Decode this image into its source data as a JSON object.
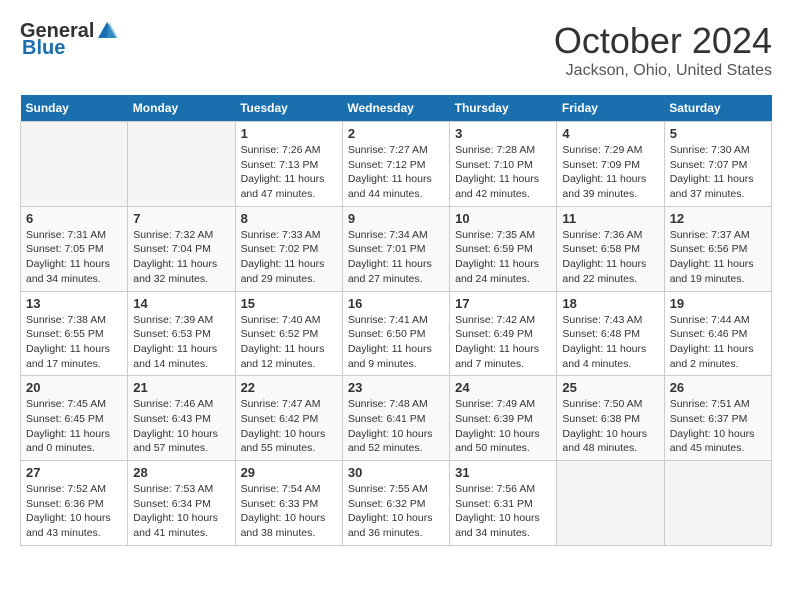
{
  "logo": {
    "general": "General",
    "blue": "Blue"
  },
  "title": {
    "month": "October 2024",
    "location": "Jackson, Ohio, United States"
  },
  "weekdays": [
    "Sunday",
    "Monday",
    "Tuesday",
    "Wednesday",
    "Thursday",
    "Friday",
    "Saturday"
  ],
  "weeks": [
    [
      {
        "day": "",
        "info": ""
      },
      {
        "day": "",
        "info": ""
      },
      {
        "day": "1",
        "info": "Sunrise: 7:26 AM\nSunset: 7:13 PM\nDaylight: 11 hours\nand 47 minutes."
      },
      {
        "day": "2",
        "info": "Sunrise: 7:27 AM\nSunset: 7:12 PM\nDaylight: 11 hours\nand 44 minutes."
      },
      {
        "day": "3",
        "info": "Sunrise: 7:28 AM\nSunset: 7:10 PM\nDaylight: 11 hours\nand 42 minutes."
      },
      {
        "day": "4",
        "info": "Sunrise: 7:29 AM\nSunset: 7:09 PM\nDaylight: 11 hours\nand 39 minutes."
      },
      {
        "day": "5",
        "info": "Sunrise: 7:30 AM\nSunset: 7:07 PM\nDaylight: 11 hours\nand 37 minutes."
      }
    ],
    [
      {
        "day": "6",
        "info": "Sunrise: 7:31 AM\nSunset: 7:05 PM\nDaylight: 11 hours\nand 34 minutes."
      },
      {
        "day": "7",
        "info": "Sunrise: 7:32 AM\nSunset: 7:04 PM\nDaylight: 11 hours\nand 32 minutes."
      },
      {
        "day": "8",
        "info": "Sunrise: 7:33 AM\nSunset: 7:02 PM\nDaylight: 11 hours\nand 29 minutes."
      },
      {
        "day": "9",
        "info": "Sunrise: 7:34 AM\nSunset: 7:01 PM\nDaylight: 11 hours\nand 27 minutes."
      },
      {
        "day": "10",
        "info": "Sunrise: 7:35 AM\nSunset: 6:59 PM\nDaylight: 11 hours\nand 24 minutes."
      },
      {
        "day": "11",
        "info": "Sunrise: 7:36 AM\nSunset: 6:58 PM\nDaylight: 11 hours\nand 22 minutes."
      },
      {
        "day": "12",
        "info": "Sunrise: 7:37 AM\nSunset: 6:56 PM\nDaylight: 11 hours\nand 19 minutes."
      }
    ],
    [
      {
        "day": "13",
        "info": "Sunrise: 7:38 AM\nSunset: 6:55 PM\nDaylight: 11 hours\nand 17 minutes."
      },
      {
        "day": "14",
        "info": "Sunrise: 7:39 AM\nSunset: 6:53 PM\nDaylight: 11 hours\nand 14 minutes."
      },
      {
        "day": "15",
        "info": "Sunrise: 7:40 AM\nSunset: 6:52 PM\nDaylight: 11 hours\nand 12 minutes."
      },
      {
        "day": "16",
        "info": "Sunrise: 7:41 AM\nSunset: 6:50 PM\nDaylight: 11 hours\nand 9 minutes."
      },
      {
        "day": "17",
        "info": "Sunrise: 7:42 AM\nSunset: 6:49 PM\nDaylight: 11 hours\nand 7 minutes."
      },
      {
        "day": "18",
        "info": "Sunrise: 7:43 AM\nSunset: 6:48 PM\nDaylight: 11 hours\nand 4 minutes."
      },
      {
        "day": "19",
        "info": "Sunrise: 7:44 AM\nSunset: 6:46 PM\nDaylight: 11 hours\nand 2 minutes."
      }
    ],
    [
      {
        "day": "20",
        "info": "Sunrise: 7:45 AM\nSunset: 6:45 PM\nDaylight: 11 hours\nand 0 minutes."
      },
      {
        "day": "21",
        "info": "Sunrise: 7:46 AM\nSunset: 6:43 PM\nDaylight: 10 hours\nand 57 minutes."
      },
      {
        "day": "22",
        "info": "Sunrise: 7:47 AM\nSunset: 6:42 PM\nDaylight: 10 hours\nand 55 minutes."
      },
      {
        "day": "23",
        "info": "Sunrise: 7:48 AM\nSunset: 6:41 PM\nDaylight: 10 hours\nand 52 minutes."
      },
      {
        "day": "24",
        "info": "Sunrise: 7:49 AM\nSunset: 6:39 PM\nDaylight: 10 hours\nand 50 minutes."
      },
      {
        "day": "25",
        "info": "Sunrise: 7:50 AM\nSunset: 6:38 PM\nDaylight: 10 hours\nand 48 minutes."
      },
      {
        "day": "26",
        "info": "Sunrise: 7:51 AM\nSunset: 6:37 PM\nDaylight: 10 hours\nand 45 minutes."
      }
    ],
    [
      {
        "day": "27",
        "info": "Sunrise: 7:52 AM\nSunset: 6:36 PM\nDaylight: 10 hours\nand 43 minutes."
      },
      {
        "day": "28",
        "info": "Sunrise: 7:53 AM\nSunset: 6:34 PM\nDaylight: 10 hours\nand 41 minutes."
      },
      {
        "day": "29",
        "info": "Sunrise: 7:54 AM\nSunset: 6:33 PM\nDaylight: 10 hours\nand 38 minutes."
      },
      {
        "day": "30",
        "info": "Sunrise: 7:55 AM\nSunset: 6:32 PM\nDaylight: 10 hours\nand 36 minutes."
      },
      {
        "day": "31",
        "info": "Sunrise: 7:56 AM\nSunset: 6:31 PM\nDaylight: 10 hours\nand 34 minutes."
      },
      {
        "day": "",
        "info": ""
      },
      {
        "day": "",
        "info": ""
      }
    ]
  ]
}
